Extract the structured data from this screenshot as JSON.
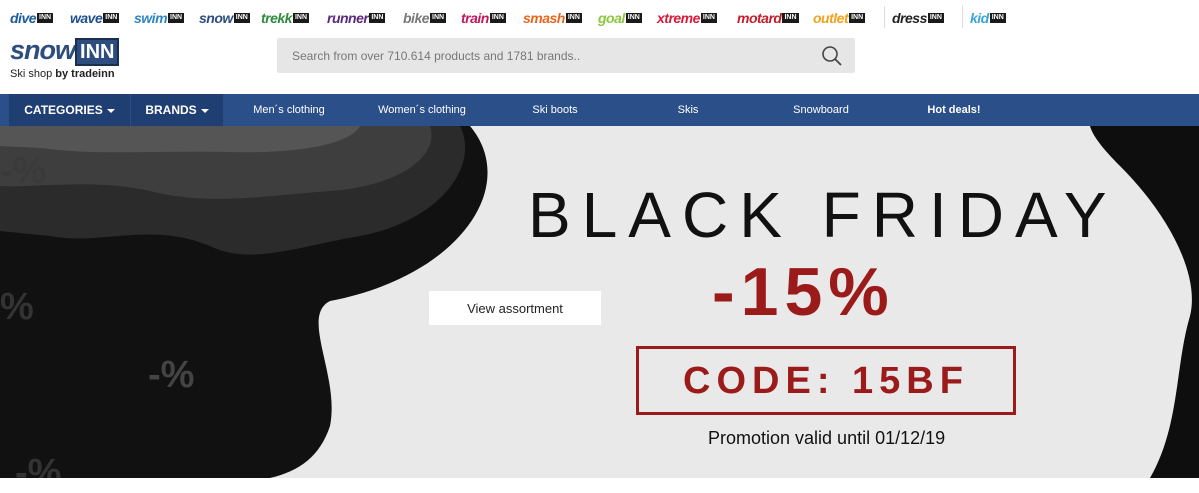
{
  "stores": [
    {
      "name": "dive",
      "color": "#1a5a9a"
    },
    {
      "name": "wave",
      "color": "#1d4f8f"
    },
    {
      "name": "swim",
      "color": "#2e86c1"
    },
    {
      "name": "snow",
      "color": "#2c4d7e"
    },
    {
      "name": "trekk",
      "color": "#2e8b3e"
    },
    {
      "name": "runner",
      "color": "#5b2a7e"
    },
    {
      "name": "bike",
      "color": "#7a7a7a"
    },
    {
      "name": "train",
      "color": "#c2185b"
    },
    {
      "name": "smash",
      "color": "#e8661c"
    },
    {
      "name": "goal",
      "color": "#8cc63f"
    },
    {
      "name": "xtreme",
      "color": "#d61d3a"
    },
    {
      "name": "motard",
      "color": "#c41e2a"
    },
    {
      "name": "outlet",
      "color": "#f0a31d"
    },
    {
      "name": "dress",
      "color": "#222222"
    },
    {
      "name": "kid",
      "color": "#3aa6d8"
    }
  ],
  "store_badge": "INN",
  "logo": {
    "word": "snow",
    "badge": "INN",
    "sub_prefix": "Ski shop",
    "sub_by": "by tradeinn"
  },
  "search": {
    "placeholder": "Search from over 710.614 products and 1781 brands..",
    "icon": "search-icon"
  },
  "nav": {
    "categories": "CATEGORIES",
    "brands": "BRANDS",
    "links": [
      "Men´s clothing",
      "Women´s clothing",
      "Ski boots",
      "Skis",
      "Snowboard",
      "Hot deals!"
    ]
  },
  "banner": {
    "title": "BLACK FRIDAY",
    "discount": "-15%",
    "code": "CODE: 15BF",
    "valid": "Promotion valid until 01/12/19",
    "button": "View assortment",
    "deco_symbols": [
      "-%",
      "%",
      "-%",
      "-%"
    ],
    "accent_color": "#9b1b1b"
  }
}
